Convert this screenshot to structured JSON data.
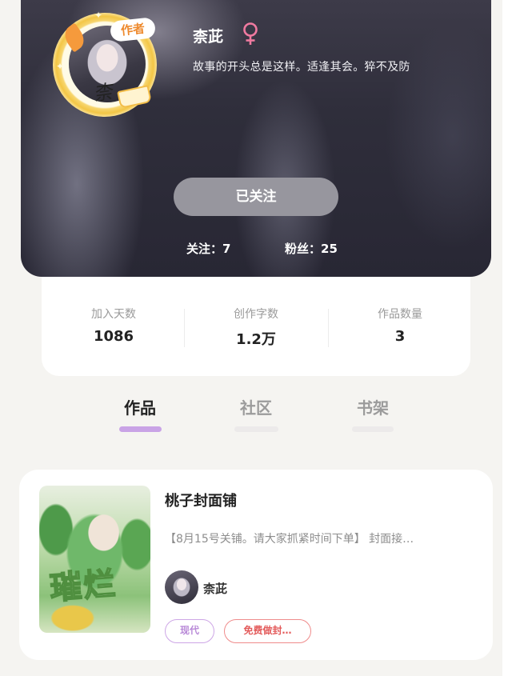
{
  "profile": {
    "author_badge": "作者",
    "avatar_script": "柰",
    "name": "柰茈",
    "gender_symbol": "♀",
    "bio": "故事的开头总是这样。适逢其会。猝不及防",
    "follow_button": "已关注",
    "following_label": "关注：",
    "following_count": "7",
    "followers_label": "粉丝：",
    "followers_count": "25"
  },
  "stats": [
    {
      "label": "加入天数",
      "value": "1086"
    },
    {
      "label": "创作字数",
      "value": "1.2万"
    },
    {
      "label": "作品数量",
      "value": "3"
    }
  ],
  "tabs": [
    {
      "label": "作品",
      "active": true
    },
    {
      "label": "社区",
      "active": false
    },
    {
      "label": "书架",
      "active": false
    }
  ],
  "work": {
    "cover_title": "璀烂",
    "title": "桃子封面铺",
    "description": "【8月15号关铺。请大家抓紧时间下单】 封面接…",
    "author_name": "柰茈",
    "tags": [
      "现代",
      "免费做封…"
    ]
  },
  "colors": {
    "accent_purple": "#c9a3e6",
    "tag_red": "#e35b5b",
    "gender_pink": "#f07aa0"
  }
}
